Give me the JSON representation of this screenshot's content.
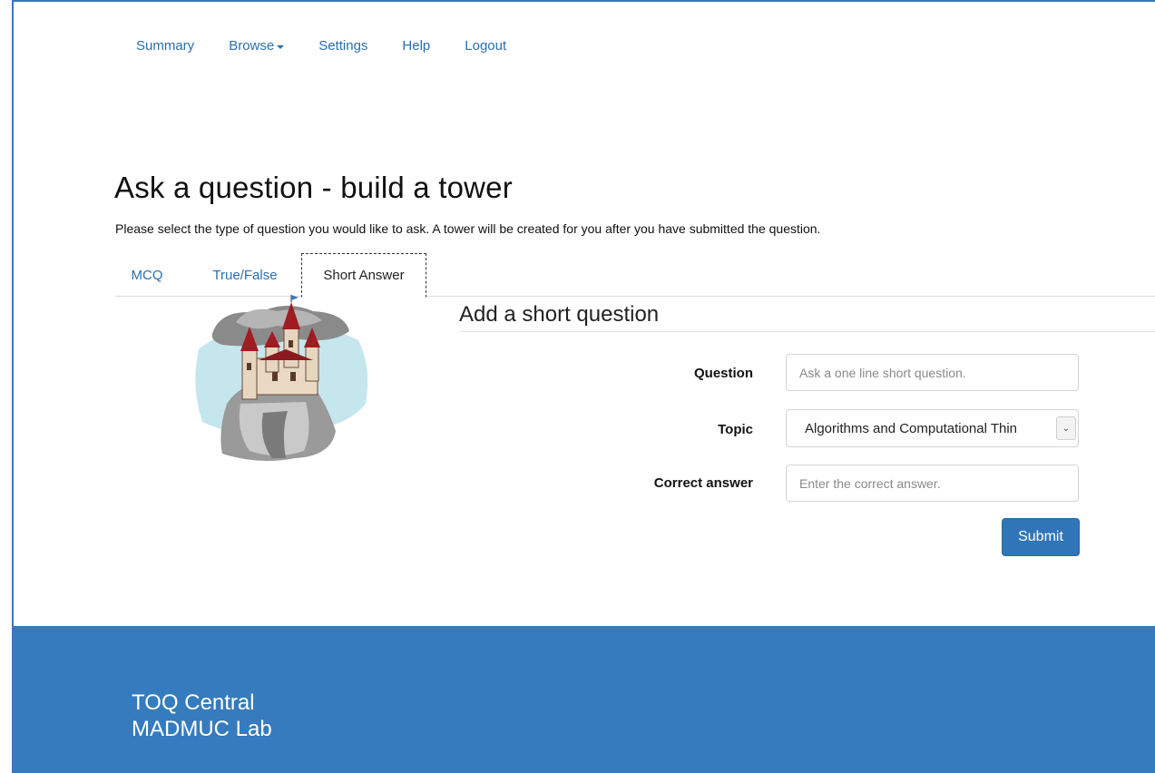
{
  "nav": {
    "items": [
      {
        "label": "Summary"
      },
      {
        "label": "Browse"
      },
      {
        "label": "Settings"
      },
      {
        "label": "Help"
      },
      {
        "label": "Logout"
      }
    ]
  },
  "page": {
    "title": "Ask a question - build a tower",
    "intro": "Please select the type of question you would like to ask. A tower will be created for you after you have submitted the question."
  },
  "tabs": [
    {
      "label": "MCQ",
      "active": false
    },
    {
      "label": "True/False",
      "active": false
    },
    {
      "label": "Short Answer",
      "active": true
    }
  ],
  "form": {
    "section_title": "Add a short question",
    "question": {
      "label": "Question",
      "placeholder": "Ask a one line short question.",
      "value": ""
    },
    "topic": {
      "label": "Topic",
      "selected": "Algorithms and Computational Thin"
    },
    "answer": {
      "label": "Correct answer",
      "placeholder": "Enter the correct answer.",
      "value": ""
    },
    "submit_label": "Submit"
  },
  "footer": {
    "line1": "TOQ Central",
    "line2": "MADMUC Lab"
  },
  "colors": {
    "link": "#2a6fb0",
    "primary": "#2f75b8",
    "footer_bg": "#357bbd"
  }
}
